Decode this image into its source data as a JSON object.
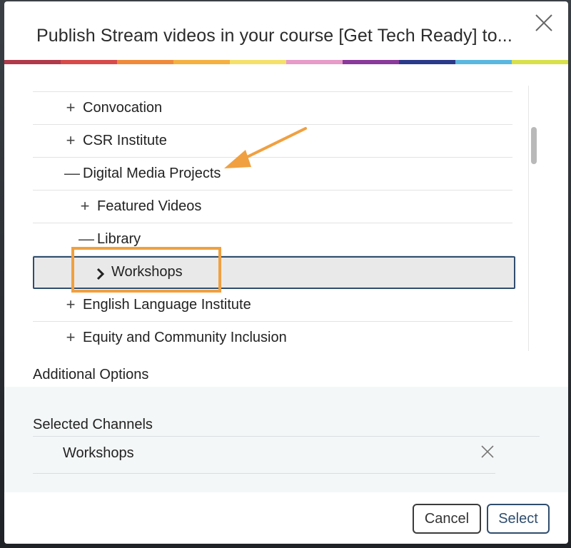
{
  "dialog": {
    "title": "Publish Stream videos in your course [Get Tech Ready] to..."
  },
  "brand_colors": [
    "#b03a4a",
    "#d84a4a",
    "#f08a3a",
    "#f5b040",
    "#f5e06a",
    "#e89ac8",
    "#8a3a9a",
    "#2a3a8a",
    "#5ab8e0",
    "#d8e04a"
  ],
  "tree": {
    "rows": [
      {
        "label": "Convocation",
        "toggle": "+",
        "depth": 1
      },
      {
        "label": "CSR Institute",
        "toggle": "+",
        "depth": 1
      },
      {
        "label": "Digital Media Projects",
        "toggle": "—",
        "depth": 1
      },
      {
        "label": "Featured Videos",
        "toggle": "+",
        "depth": 2
      },
      {
        "label": "Library",
        "toggle": "—",
        "depth": 2
      },
      {
        "label": "Workshops",
        "toggle": "chevron",
        "depth": 3,
        "selected": true
      },
      {
        "label": "English Language Institute",
        "toggle": "+",
        "depth": 1
      },
      {
        "label": "Equity and Community Inclusion",
        "toggle": "+",
        "depth": 1
      }
    ]
  },
  "additional_options": {
    "label": "Additional Options"
  },
  "selected_channels": {
    "title": "Selected Channels",
    "items": [
      {
        "label": "Workshops"
      }
    ]
  },
  "footer": {
    "cancel_label": "Cancel",
    "select_label": "Select"
  },
  "annotation_color": "#f0a040",
  "selection_border_color": "#2f4d6e"
}
